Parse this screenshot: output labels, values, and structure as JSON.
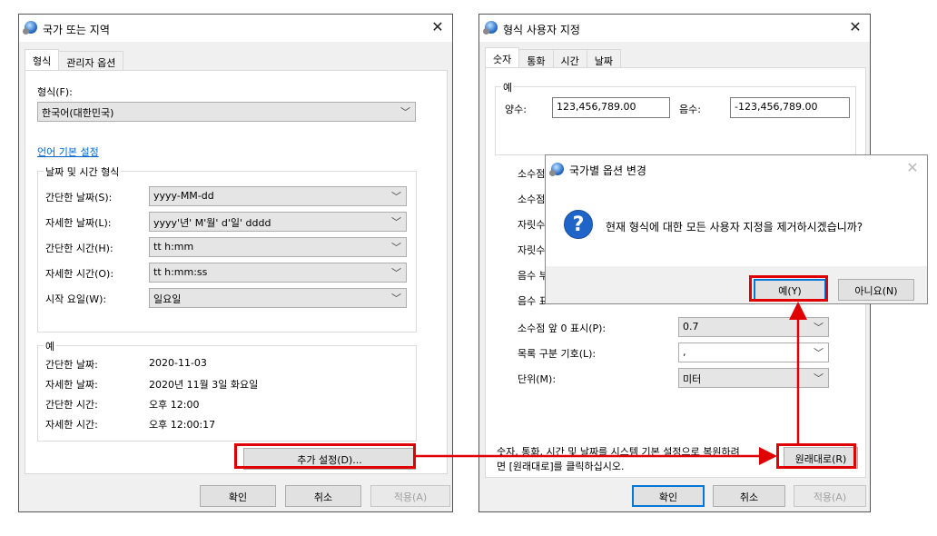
{
  "left_window": {
    "title": "국가 또는 지역",
    "tabs": [
      "형식",
      "관리자 옵션"
    ],
    "format_label": "형식(F):",
    "format_value": "한국어(대한민국)",
    "language_link": "언어 기본 설정",
    "datetime_group": "날짜 및 시간 형식",
    "fields": [
      {
        "label": "간단한 날짜(S):",
        "value": "yyyy-MM-dd"
      },
      {
        "label": "자세한 날짜(L):",
        "value": "yyyy'년' M'월' d'일' dddd"
      },
      {
        "label": "간단한 시간(H):",
        "value": "tt h:mm"
      },
      {
        "label": "자세한 시간(O):",
        "value": "tt h:mm:ss"
      },
      {
        "label": "시작 요일(W):",
        "value": "일요일"
      }
    ],
    "example_group": "예",
    "examples": [
      {
        "label": "간단한 날짜:",
        "value": "2020-11-03"
      },
      {
        "label": "자세한 날짜:",
        "value": "2020년 11월 3일 화요일"
      },
      {
        "label": "간단한 시간:",
        "value": "오후 12:00"
      },
      {
        "label": "자세한 시간:",
        "value": "오후 12:00:17"
      }
    ],
    "additional_button": "추가 설정(D)...",
    "ok": "확인",
    "cancel": "취소",
    "apply": "적용(A)"
  },
  "right_window": {
    "title": "형식 사용자 지정",
    "tabs": [
      "숫자",
      "통화",
      "시간",
      "날짜"
    ],
    "example_group": "예",
    "positive_label": "양수:",
    "positive_value": "123,456,789.00",
    "negative_label": "음수:",
    "negative_value": "-123,456,789.00",
    "partial_labels": [
      "소수점",
      "소수점",
      "자릿수",
      "자릿수",
      "음수 부",
      "음수 표"
    ],
    "rows": [
      {
        "label": "소수점 앞 0 표시(P):",
        "value": "0.7"
      },
      {
        "label": "목록 구분 기호(L):",
        "value": ","
      },
      {
        "label": "단위(M):",
        "value": "미터"
      }
    ],
    "reset_text_line1": "숫자, 통화, 시간 및 날짜를 시스템 기본 설정으로 복원하려",
    "reset_text_line2": "면 [원래대로]를 클릭하십시오.",
    "reset_button": "원래대로(R)",
    "ok": "확인",
    "cancel": "취소",
    "apply": "적용(A)"
  },
  "dialog": {
    "title": "국가별 옵션 변경",
    "message": "현재 형식에 대한 모든 사용자 지정을 제거하시겠습니까?",
    "yes": "예(Y)",
    "no": "아니요(N)"
  },
  "colors": {
    "highlight": "#e00000",
    "accent": "#0078d7"
  }
}
